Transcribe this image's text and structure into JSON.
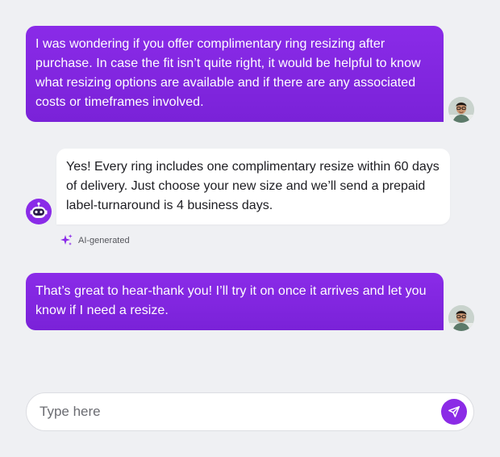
{
  "messages": [
    {
      "role": "user",
      "text": "I was wondering if you offer complimentary ring resizing after purchase. In case the fit isn’t quite right, it would be helpful to know what resizing options are available and if there are any associated costs or timeframes involved."
    },
    {
      "role": "bot",
      "text": "Yes! Every ring includes one complimentary resize within 60 days of delivery. Just choose your new size and we’ll send a prepaid label-turnaround is 4 business days.",
      "badge": "AI-generated"
    },
    {
      "role": "user",
      "text": "That’s great to hear-thank you! I’ll try it on once it arrives and let you know if I need a resize."
    }
  ],
  "composer": {
    "placeholder": "Type here",
    "value": ""
  },
  "icons": {
    "user_avatar": "user-avatar-photo",
    "bot_avatar": "robot-icon",
    "ai_badge": "sparkle-icon",
    "send": "send-icon"
  },
  "colors": {
    "accent": "#8a2be8",
    "background": "#eff0f3",
    "bot_bubble": "#ffffff"
  }
}
